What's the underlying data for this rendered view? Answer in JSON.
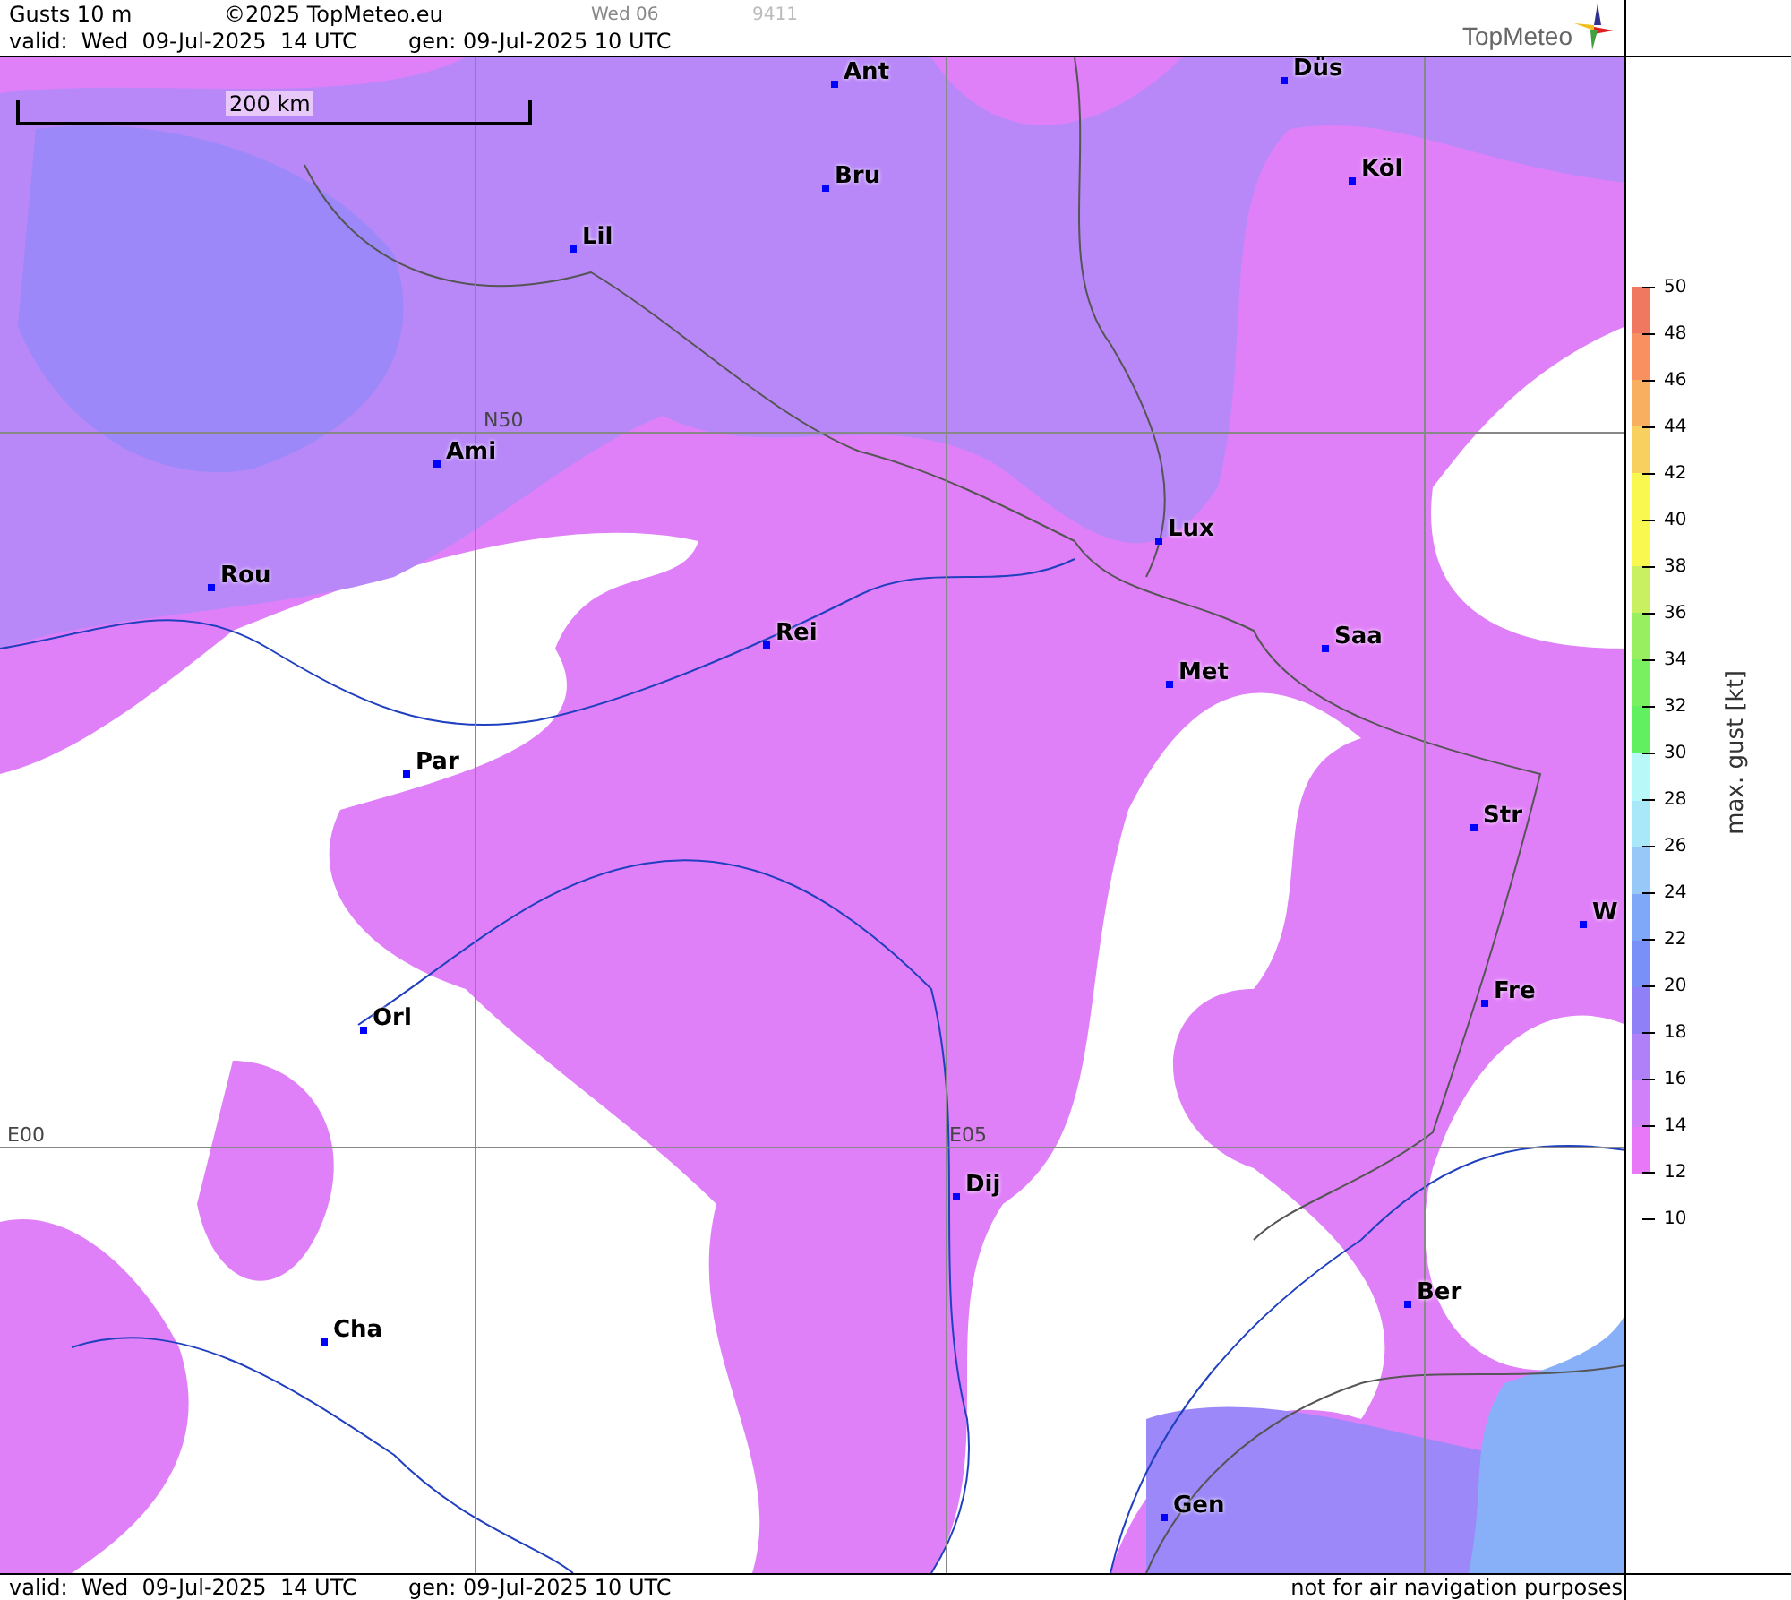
{
  "header": {
    "product": "Gusts 10 m",
    "copyright": "©2025 TopMeteo.eu",
    "day_code": "Wed 06",
    "run_code": "9411",
    "valid": "valid:  Wed  09-Jul-2025  14 UTC",
    "generated": "gen: 09-Jul-2025 10 UTC",
    "logo": "TopMeteo"
  },
  "map": {
    "scale": "200 km",
    "grid_labels": [
      "N50",
      "E00",
      "E05"
    ],
    "cities": [
      {
        "name": "Ant"
      },
      {
        "name": "Düs"
      },
      {
        "name": "Köl"
      },
      {
        "name": "Bru"
      },
      {
        "name": "Lil"
      },
      {
        "name": "Ami"
      },
      {
        "name": "Rou"
      },
      {
        "name": "Lux"
      },
      {
        "name": "Saa"
      },
      {
        "name": "Rei"
      },
      {
        "name": "Met"
      },
      {
        "name": "Par"
      },
      {
        "name": "Str"
      },
      {
        "name": "W"
      },
      {
        "name": "Fre"
      },
      {
        "name": "Orl"
      },
      {
        "name": "Dij"
      },
      {
        "name": "Ber"
      },
      {
        "name": "Cha"
      },
      {
        "name": "Gen"
      }
    ]
  },
  "legend": {
    "title": "max. gust [kt]",
    "bands": [
      {
        "color": "#f07860"
      },
      {
        "color": "#f89060"
      },
      {
        "color": "#f8b060"
      },
      {
        "color": "#f8d060"
      },
      {
        "color": "#f8f850"
      },
      {
        "color": "#f8f850"
      },
      {
        "color": "#c8f060"
      },
      {
        "color": "#98f060"
      },
      {
        "color": "#78f060"
      },
      {
        "color": "#60f060"
      },
      {
        "color": "#b8f8f8"
      },
      {
        "color": "#a8e8f8"
      },
      {
        "color": "#98c8f8"
      },
      {
        "color": "#80a8f8"
      },
      {
        "color": "#7890f8"
      },
      {
        "color": "#9080f8"
      },
      {
        "color": "#b080f8"
      },
      {
        "color": "#d080f8"
      },
      {
        "color": "#e878f8"
      }
    ],
    "ticks": [
      "50",
      "48",
      "46",
      "44",
      "42",
      "40",
      "38",
      "36",
      "34",
      "32",
      "30",
      "28",
      "26",
      "24",
      "22",
      "20",
      "18",
      "16",
      "14",
      "12",
      "10"
    ]
  },
  "footer": {
    "valid": "valid:  Wed  09-Jul-2025  14 UTC",
    "generated": "gen: 09-Jul-2025 10 UTC",
    "disclaimer": "not for air navigation purposes"
  }
}
